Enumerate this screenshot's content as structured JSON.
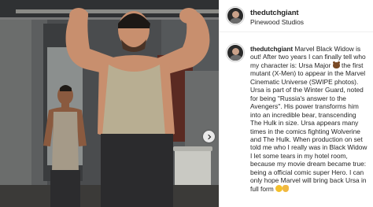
{
  "post": {
    "username": "thedutchgiant",
    "location": "Pinewood Studios",
    "caption": {
      "username": "thedutchgiant",
      "segments": [
        " Marvel Black Widow is out! After two years I can finally tell who my character is: Ursa Major ",
        " the first mutant (X-Men) to appear in the Marvel Cinematic Universe (SWIPE photos). Ursa is part of the Winter Guard, noted for being \"Russia's answer to the Avengers\". His power transforms him into an incredible bear, transcending The Hulk in size. Ursa appears many times in the comics fighting Wolverine and The Hulk. When production on set told me who I really was in Black Widow I let some tears in my hotel room, because my movie dream became true: being a official comic super Hero. I can only hope Marvel will bring back Ursa in full form "
      ]
    },
    "icons": {
      "avatar": "profile-avatar",
      "carousel_next": "chevron-right-icon",
      "emoji_1": "bear-emoji",
      "emoji_2": "saluting-face-emoji",
      "emoji_3": "crossed-fingers-emoji"
    }
  }
}
